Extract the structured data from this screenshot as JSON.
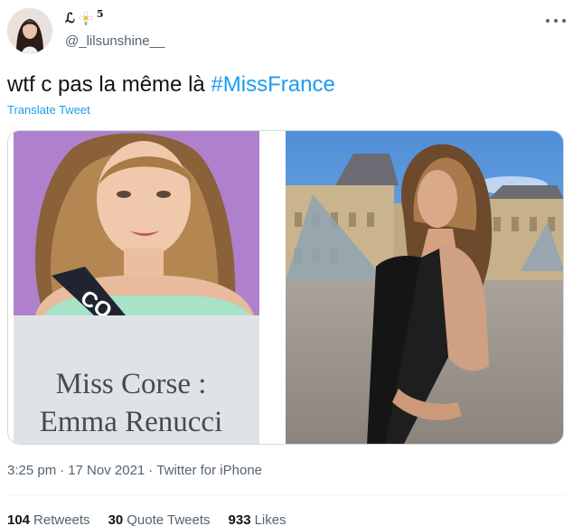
{
  "author": {
    "display_name": "ℒ",
    "display_name_suffix": "5",
    "handle": "@_lilsunshine__",
    "avatar_icon": "profile-photo"
  },
  "tweet": {
    "text": "wtf c pas la même là ",
    "hashtag": "#MissFrance",
    "translate_label": "Translate Tweet"
  },
  "media": {
    "left_caption_line1": "Miss Corse :",
    "left_caption_line2": "Emma Renucci"
  },
  "meta": {
    "time": "3:25 pm",
    "date": "17 Nov 2021",
    "separator": "·",
    "source": "Twitter for iPhone"
  },
  "stats": {
    "retweets_count": "104",
    "retweets_label": "Retweets",
    "quotes_count": "30",
    "quotes_label": "Quote Tweets",
    "likes_count": "933",
    "likes_label": "Likes"
  },
  "colors": {
    "link": "#1d9bf0",
    "secondary_text": "#536471",
    "primary_text": "#0f1419"
  }
}
